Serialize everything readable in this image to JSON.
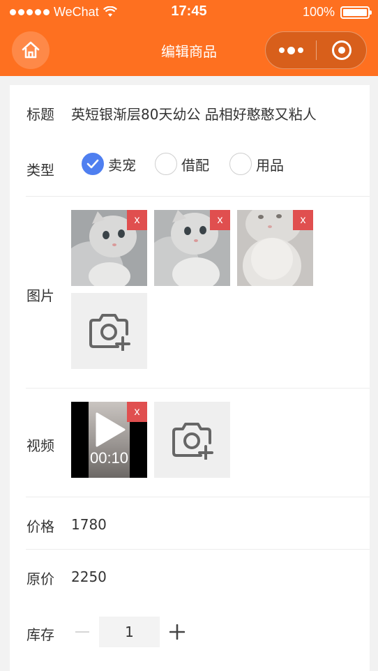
{
  "status_bar": {
    "carrier": "WeChat",
    "time": "17:45",
    "battery": "100%"
  },
  "nav": {
    "title": "编辑商品"
  },
  "form": {
    "title_label": "标题",
    "title_value": "英短银渐层80天幼公 品相好憨憨又粘人",
    "type_label": "类型",
    "type_options": [
      "卖宠",
      "借配",
      "用品"
    ],
    "type_selected": "卖宠",
    "images_label": "图片",
    "image_count": 3,
    "delete_mark": "x",
    "video_label": "视频",
    "video_duration": "00:10",
    "price_label": "价格",
    "price_value": "1780",
    "orig_price_label": "原价",
    "orig_price_value": "2250",
    "stock_label": "库存",
    "stock_value": "1"
  },
  "colors": {
    "brand": "#fe7020",
    "radio_checked": "#4f7ff0",
    "delete": "#e04f4f"
  },
  "icons": [
    "home-icon",
    "more-icon",
    "close-circle-icon",
    "radio-check-icon",
    "camera-plus-icon",
    "play-icon",
    "minus-icon",
    "plus-icon"
  ]
}
